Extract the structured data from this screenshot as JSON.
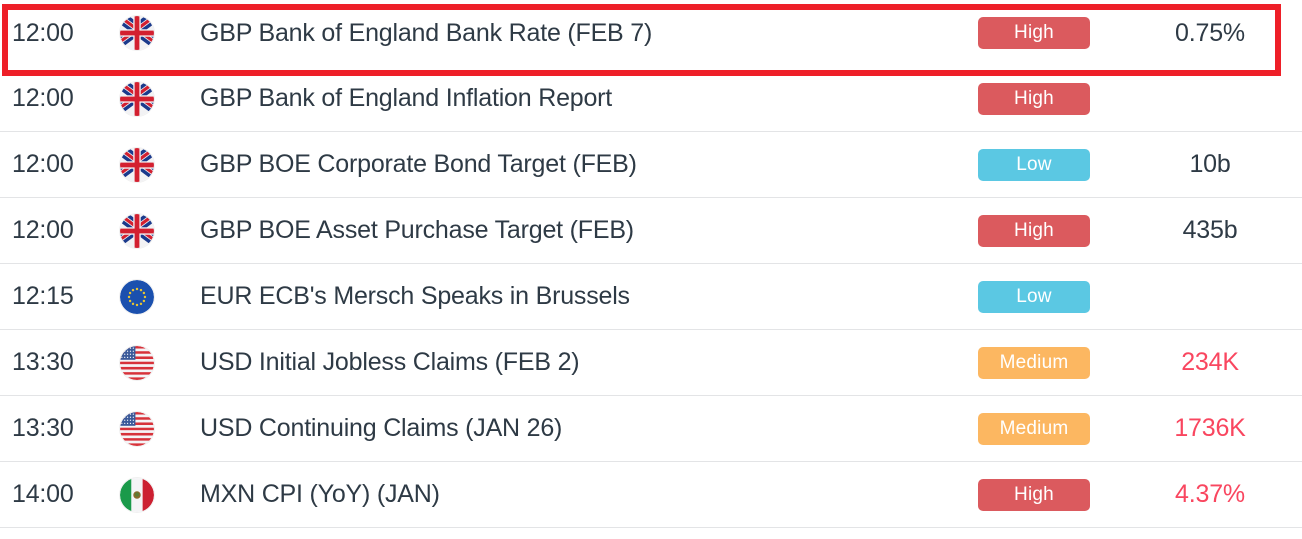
{
  "table": {
    "columns": [
      "time",
      "flag",
      "event",
      "impact",
      "actual"
    ],
    "rows": [
      {
        "time": "12:00",
        "flag": "uk-flag-icon",
        "flag_name": "United Kingdom",
        "event": "GBP Bank of England Bank Rate (FEB 7)",
        "impact": "High",
        "impact_color": "#db5a5e",
        "value": "0.75%",
        "value_alert": false,
        "highlighted": true
      },
      {
        "time": "12:00",
        "flag": "uk-flag-icon",
        "flag_name": "United Kingdom",
        "event": "GBP Bank of England Inflation Report",
        "impact": "High",
        "impact_color": "#db5a5e",
        "value": "",
        "value_alert": false,
        "highlighted": false
      },
      {
        "time": "12:00",
        "flag": "uk-flag-icon",
        "flag_name": "United Kingdom",
        "event": "GBP BOE Corporate Bond Target (FEB)",
        "impact": "Low",
        "impact_color": "#5bc8e3",
        "value": "10b",
        "value_alert": false,
        "highlighted": false
      },
      {
        "time": "12:00",
        "flag": "uk-flag-icon",
        "flag_name": "United Kingdom",
        "event": "GBP BOE Asset Purchase Target (FEB)",
        "impact": "High",
        "impact_color": "#db5a5e",
        "value": "435b",
        "value_alert": false,
        "highlighted": false
      },
      {
        "time": "12:15",
        "flag": "eu-flag-icon",
        "flag_name": "European Union",
        "event": "EUR ECB's Mersch Speaks in Brussels",
        "impact": "Low",
        "impact_color": "#5bc8e3",
        "value": "",
        "value_alert": false,
        "highlighted": false
      },
      {
        "time": "13:30",
        "flag": "us-flag-icon",
        "flag_name": "United States",
        "event": "USD Initial Jobless Claims (FEB 2)",
        "impact": "Medium",
        "impact_color": "#fcb761",
        "value": "234K",
        "value_alert": true,
        "highlighted": false
      },
      {
        "time": "13:30",
        "flag": "us-flag-icon",
        "flag_name": "United States",
        "event": "USD Continuing Claims (JAN 26)",
        "impact": "Medium",
        "impact_color": "#fcb761",
        "value": "1736K",
        "value_alert": true,
        "highlighted": false
      },
      {
        "time": "14:00",
        "flag": "mx-flag-icon",
        "flag_name": "Mexico",
        "event": "MXN CPI (YoY) (JAN)",
        "impact": "High",
        "impact_color": "#db5a5e",
        "value": "4.37%",
        "value_alert": true,
        "highlighted": false
      }
    ]
  },
  "highlight": {
    "color": "#ee1f28",
    "target_row_index": 0
  },
  "colors": {
    "text": "#2e3a45",
    "alert_value": "#f9465f",
    "divider": "#e3e4e6",
    "impact_high": "#db5a5e",
    "impact_medium": "#fcb761",
    "impact_low": "#5bc8e3"
  }
}
